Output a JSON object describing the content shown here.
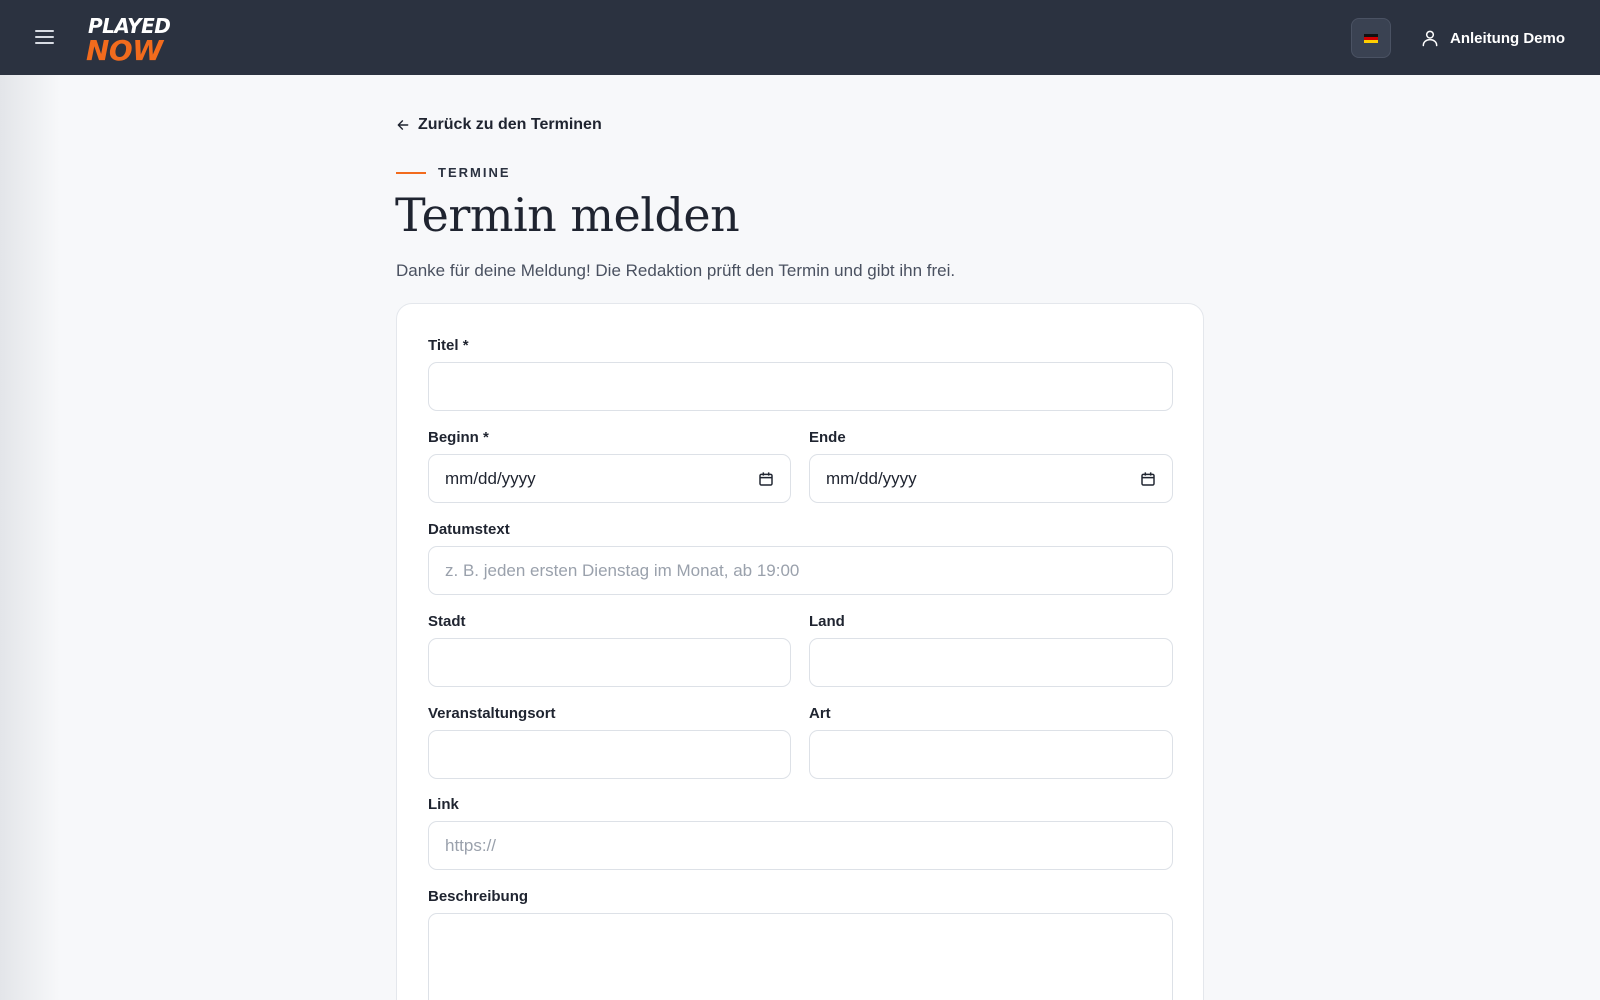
{
  "header": {
    "logo_top": "PLAYED",
    "logo_bottom": "NOW",
    "user_name": "Anleitung Demo",
    "icons": {
      "menu": "hamburger-menu-icon",
      "user": "user-icon",
      "flag": "german-flag-icon"
    }
  },
  "colors": {
    "topbar": "#2b3240",
    "accent": "#f26b1d",
    "background": "#f7f8fa"
  },
  "nav": {
    "back_label": "Zurück zu den Terminen"
  },
  "page": {
    "eyebrow": "TERMINE",
    "title": "Termin melden",
    "subtitle": "Danke für deine Meldung! Die Redaktion prüft den Termin und gibt ihn frei."
  },
  "form": {
    "title": {
      "label": "Titel *",
      "value": "",
      "placeholder": ""
    },
    "begin": {
      "label": "Beginn *",
      "value": "mm/dd/yyyy"
    },
    "end": {
      "label": "Ende",
      "value": "mm/dd/yyyy"
    },
    "date_text": {
      "label": "Datumstext",
      "value": "",
      "placeholder": "z. B. jeden ersten Dienstag im Monat, ab 19:00"
    },
    "city": {
      "label": "Stadt",
      "value": "",
      "placeholder": ""
    },
    "country": {
      "label": "Land",
      "value": "",
      "placeholder": ""
    },
    "venue": {
      "label": "Veranstaltungsort",
      "value": "",
      "placeholder": ""
    },
    "type": {
      "label": "Art",
      "value": "",
      "placeholder": ""
    },
    "link": {
      "label": "Link",
      "value": "",
      "placeholder": "https://"
    },
    "description": {
      "label": "Beschreibung",
      "value": "",
      "placeholder": ""
    }
  }
}
